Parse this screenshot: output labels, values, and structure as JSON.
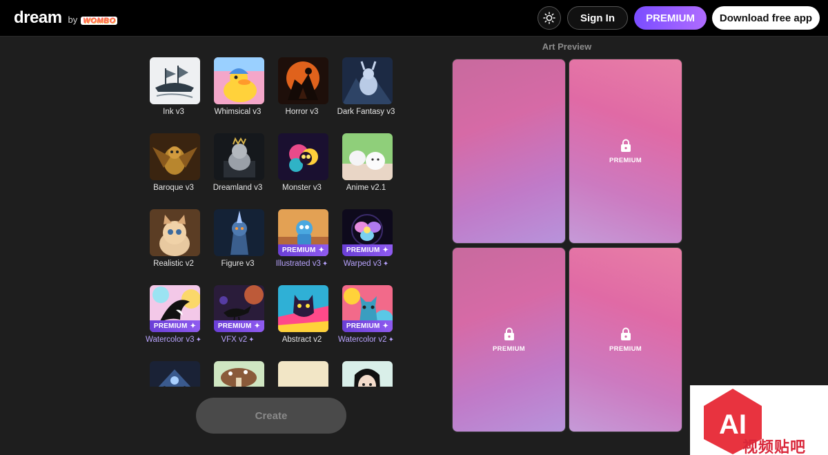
{
  "header": {
    "logo_main": "dream",
    "logo_by": "by",
    "logo_brand": "WOMBO",
    "signin_label": "Sign In",
    "premium_label": "PREMIUM",
    "download_label": "Download free app"
  },
  "styles": [
    {
      "label": "Ink v3",
      "premium": false,
      "theme": "ink"
    },
    {
      "label": "Whimsical v3",
      "premium": false,
      "theme": "whimsical"
    },
    {
      "label": "Horror v3",
      "premium": false,
      "theme": "horror"
    },
    {
      "label": "Dark Fantasy v3",
      "premium": false,
      "theme": "darkfantasy"
    },
    {
      "label": "Baroque v3",
      "premium": false,
      "theme": "baroque"
    },
    {
      "label": "Dreamland v3",
      "premium": false,
      "theme": "dreamland"
    },
    {
      "label": "Monster v3",
      "premium": false,
      "theme": "monster"
    },
    {
      "label": "Anime v2.1",
      "premium": false,
      "theme": "anime"
    },
    {
      "label": "Realistic v2",
      "premium": false,
      "theme": "realistic"
    },
    {
      "label": "Figure v3",
      "premium": false,
      "theme": "figure"
    },
    {
      "label": "Illustrated v3",
      "premium": true,
      "theme": "illustrated"
    },
    {
      "label": "Warped v3",
      "premium": true,
      "theme": "warped"
    },
    {
      "label": "Watercolor v3",
      "premium": true,
      "theme": "watercolor3"
    },
    {
      "label": "VFX v2",
      "premium": true,
      "theme": "vfx"
    },
    {
      "label": "Abstract v2",
      "premium": false,
      "theme": "abstract"
    },
    {
      "label": "Watercolor v2",
      "premium": true,
      "theme": "watercolor2"
    },
    {
      "label": "",
      "premium": false,
      "theme": "row5a"
    },
    {
      "label": "",
      "premium": false,
      "theme": "row5b"
    },
    {
      "label": "",
      "premium": false,
      "theme": "row5c"
    },
    {
      "label": "",
      "premium": false,
      "theme": "row5d"
    }
  ],
  "badge_label": "PREMIUM",
  "create_label": "Create",
  "preview": {
    "title": "Art Preview",
    "cards": [
      {
        "locked": false,
        "label": ""
      },
      {
        "locked": true,
        "label": "PREMIUM"
      },
      {
        "locked": true,
        "label": "PREMIUM"
      },
      {
        "locked": true,
        "label": "PREMIUM"
      }
    ]
  },
  "watermark": {
    "mark": "AI",
    "text": "视频贴吧"
  },
  "icons": {
    "theme_toggle": "sun-icon",
    "lock": "lock-icon",
    "sparkle": "sparkle-icon"
  },
  "colors": {
    "accent": "#7a4dff",
    "premium_text": "#b9a4ff"
  }
}
